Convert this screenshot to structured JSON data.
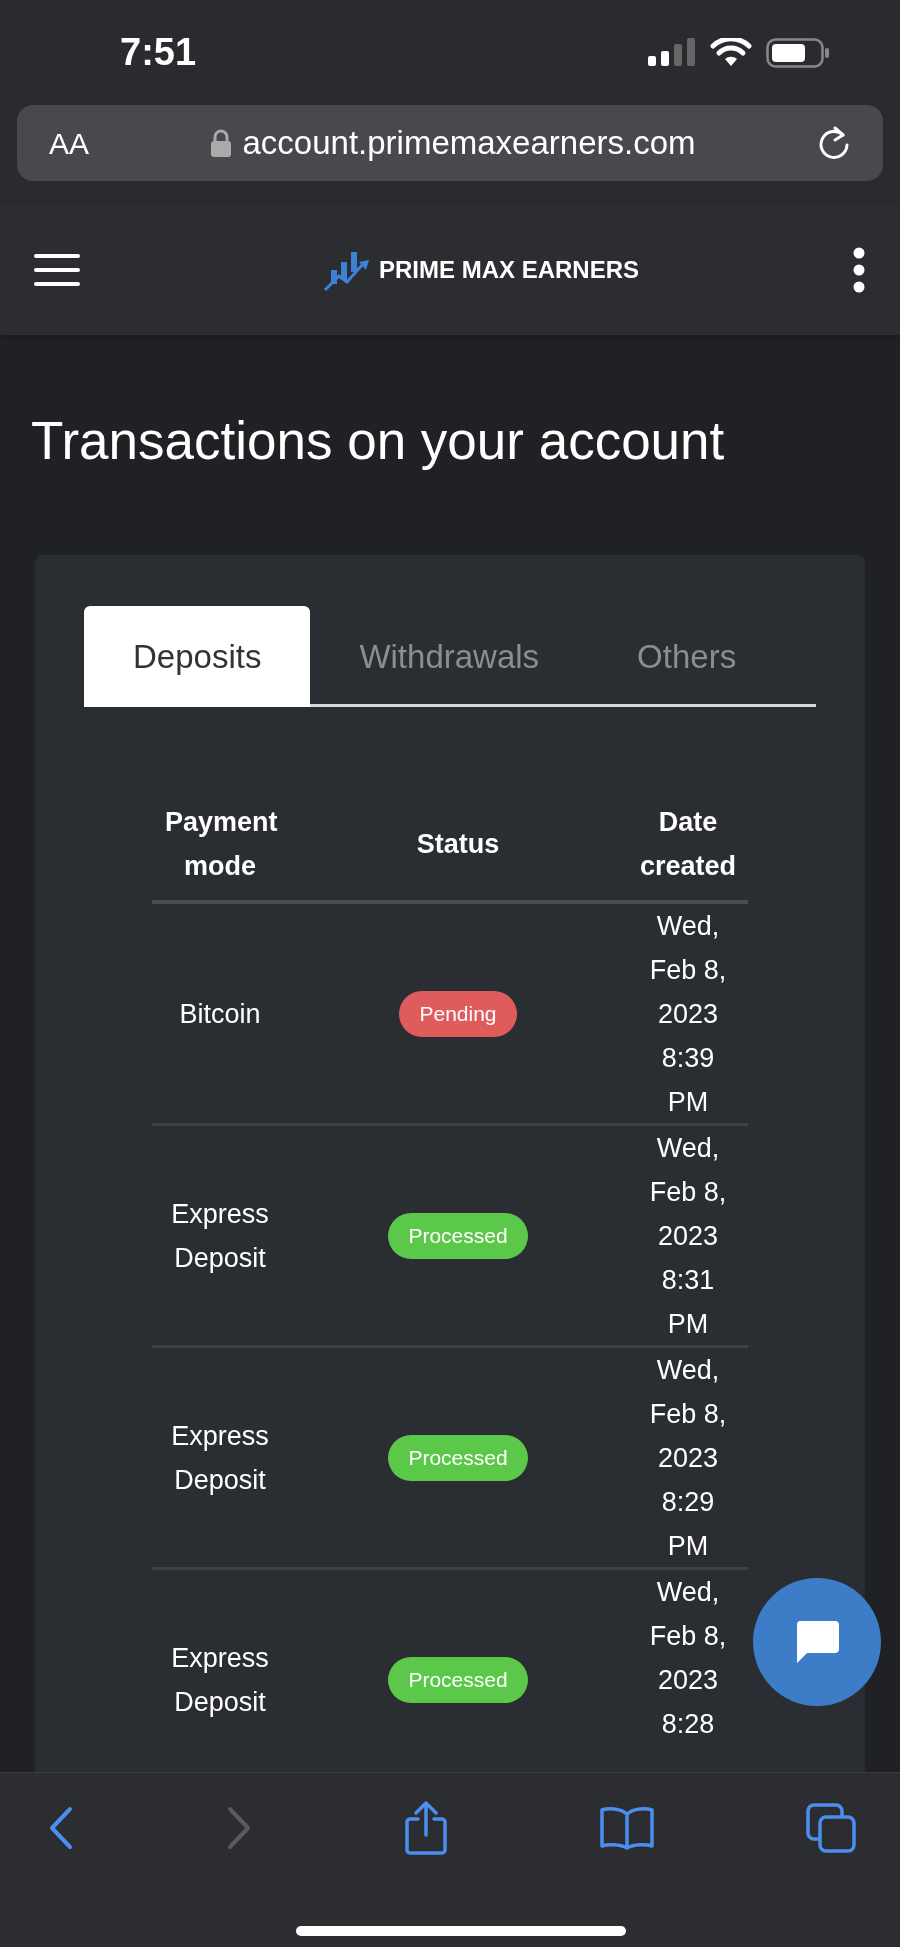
{
  "status_bar": {
    "time": "7:51"
  },
  "browser": {
    "text_size_label": "AA",
    "url": "account.primemaxearners.com",
    "back_enabled": true,
    "forward_enabled": false
  },
  "header": {
    "brand": "PRIME MAX EARNERS"
  },
  "page_title": "Transactions on your account",
  "tabs": [
    {
      "label": "Deposits",
      "selected": true
    },
    {
      "label": "Withdrawals",
      "selected": false
    },
    {
      "label": "Others",
      "selected": false
    }
  ],
  "table": {
    "columns": [
      "Payment mode",
      "Status",
      "Date created"
    ],
    "rows": [
      {
        "payment_mode": "Bitcoin",
        "status": {
          "label": "Pending",
          "kind": "pending"
        },
        "date_created": "Wed, Feb 8, 2023 8:39 PM"
      },
      {
        "payment_mode": "Express Deposit",
        "status": {
          "label": "Processed",
          "kind": "processed"
        },
        "date_created": "Wed, Feb 8, 2023 8:31 PM"
      },
      {
        "payment_mode": "Express Deposit",
        "status": {
          "label": "Processed",
          "kind": "processed"
        },
        "date_created": "Wed, Feb 8, 2023 8:29 PM"
      },
      {
        "payment_mode": "Express Deposit",
        "status": {
          "label": "Processed",
          "kind": "processed"
        },
        "date_created": "Wed, Feb 8, 2023 8:28"
      }
    ]
  }
}
